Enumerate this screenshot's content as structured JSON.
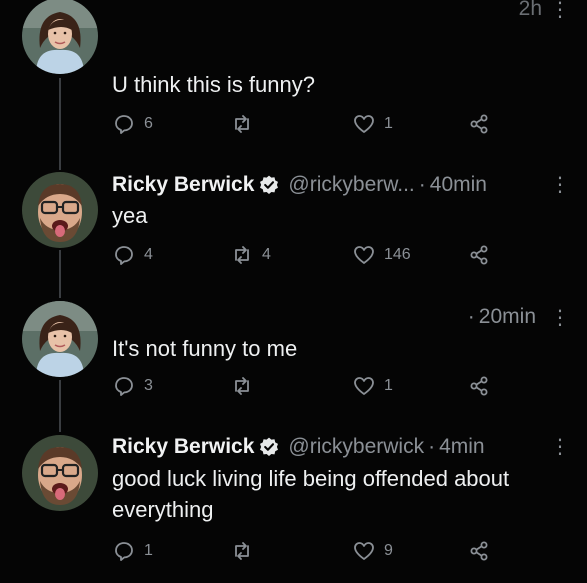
{
  "tweets": [
    {
      "time": "2h",
      "text": "U think this is funny?",
      "reply_count": "6",
      "retweet_count": "",
      "like_count": "1"
    },
    {
      "name": "Ricky Berwick",
      "handle": "@rickyberw...",
      "time": "40min",
      "text": "yea",
      "reply_count": "4",
      "retweet_count": "4",
      "like_count": "146"
    },
    {
      "time": "20min",
      "text": "It's not funny to me",
      "reply_count": "3",
      "retweet_count": "",
      "like_count": "1"
    },
    {
      "name": "Ricky Berwick",
      "handle": "@rickyberwick",
      "time": "4min",
      "text": "good luck living life being offended about everything",
      "reply_count": "1",
      "retweet_count": "",
      "like_count": "9"
    }
  ],
  "icons": {
    "reply": "speech-bubble",
    "retweet": "retweet-arrows",
    "like": "heart",
    "share": "share-nodes",
    "more": "vertical-dots",
    "verified": "verified-badge"
  },
  "colors": {
    "background": "#050505",
    "text": "#e7e9ea",
    "muted": "#8b9096",
    "thread_line": "#3a3d41"
  }
}
